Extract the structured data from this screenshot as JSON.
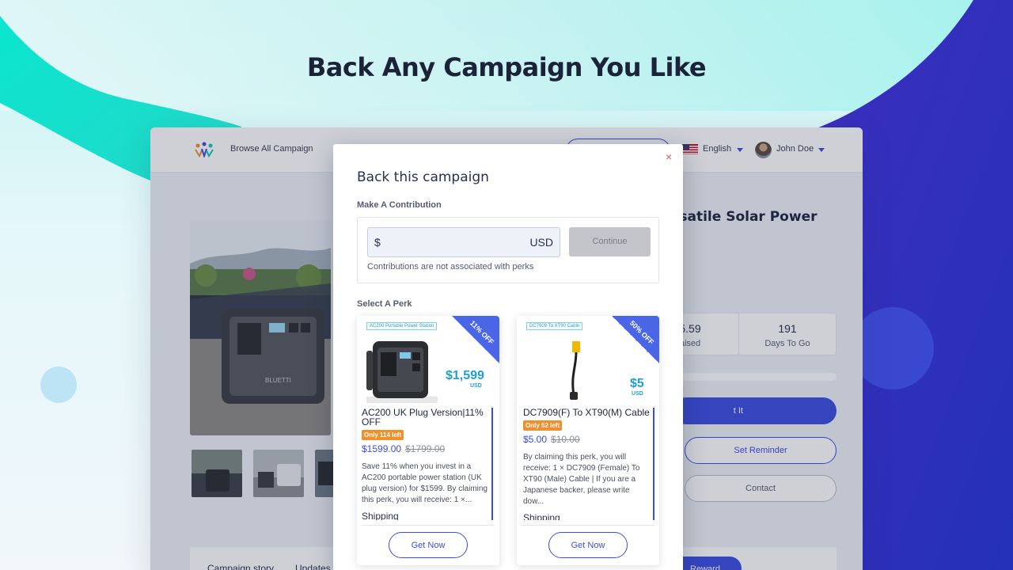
{
  "hero": {
    "title": "Back Any Campaign You Like"
  },
  "app_nav": {
    "browse_label": "Browse All Campaign",
    "language": "English",
    "user_name": "John Doe"
  },
  "campaign": {
    "title_fragment": "rsatile Solar Power",
    "stats": [
      {
        "value": "5.59",
        "label": "aised"
      },
      {
        "value": "191",
        "label": "Days To Go"
      }
    ],
    "back_button_fragment": "t It",
    "reminder_label": "Set Reminder",
    "contact_label": "Contact",
    "tabs": [
      "Campaign story",
      "Updates"
    ],
    "reward_button_fragment": "Reward"
  },
  "modal": {
    "title": "Back this campaign",
    "contribution_label": "Make A Contribution",
    "currency_symbol": "$",
    "currency_code": "USD",
    "amount_value": "",
    "continue_label": "Continue",
    "contribution_note": "Contributions are not associated with perks",
    "perk_section_label": "Select A Perk",
    "close_icon": "×"
  },
  "perks": [
    {
      "image_tagline": "AC200 Portable Power Station",
      "discount_badge": "11% OFF",
      "image_price": "$1,599",
      "image_price_unit": "USD",
      "name": "AC200 UK Plug Version|11% OFF",
      "stock_badge": "Only 114 left",
      "price_now": "$1599.00",
      "price_was": "$1799.00",
      "description": "Save 11% when you invest in a AC200 portable power station (UK plug version) for $1599. By claiming this perk, you will receive: 1 ×...",
      "shipping_label": "Shipping",
      "button_label": "Get Now"
    },
    {
      "image_tagline": "DC7909 To XT90 Cable",
      "discount_badge": "50% OFF",
      "image_price": "$5",
      "image_price_unit": "USD",
      "name": "DC7909(F) To XT90(M) Cable",
      "stock_badge": "Only 52 left",
      "price_now": "$5.00",
      "price_was": "$10.00",
      "description": "By claiming this perk, you will receive: 1 × DC7909 (Female) To XT90 (Male) Cable | If you are a Japanese backer, please write dow...",
      "shipping_label": "Shipping",
      "button_label": "Get Now"
    }
  ],
  "colors": {
    "accent": "#3b4de0",
    "teal_wave": "#14dcc8",
    "deep_blue_wave": "#2e2fb0",
    "stock_badge": "#f0902c",
    "discount_corner": "#4a66e6",
    "close_icon": "#e05a5a"
  }
}
